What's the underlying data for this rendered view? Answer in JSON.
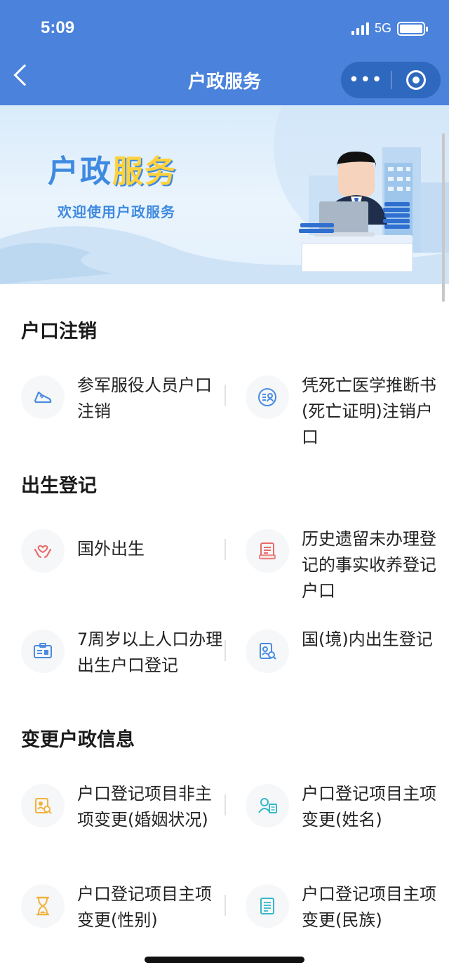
{
  "status_bar": {
    "time": "5:09",
    "network": "5G"
  },
  "nav": {
    "title": "户政服务"
  },
  "banner": {
    "title_part1": "户政",
    "title_part2": "服务",
    "subtitle": "欢迎使用户政服务"
  },
  "sections": [
    {
      "title": "户口注销",
      "items": [
        {
          "label": "参军服役人员户口注销",
          "icon": "running-shoe-icon"
        },
        {
          "label": "凭死亡医学推断书(死亡证明)注销户口",
          "icon": "person-list-icon"
        }
      ]
    },
    {
      "title": "出生登记",
      "items": [
        {
          "label": "国外出生",
          "icon": "caring-hands-icon"
        },
        {
          "label": "历史遗留未办理登记的事实收养登记户口",
          "icon": "document-icon"
        },
        {
          "label": "7周岁以上人口办理出生户口登记",
          "icon": "id-card-icon"
        },
        {
          "label": "国(境)内出生登记",
          "icon": "document-search-icon"
        }
      ]
    },
    {
      "title": "变更户政信息",
      "items": [
        {
          "label": "户口登记项目非主项变更(婚姻状况)",
          "icon": "id-search-icon"
        },
        {
          "label": "户口登记项目主项变更(姓名)",
          "icon": "user-card-icon"
        },
        {
          "label": "户口登记项目主项变更(性别)",
          "icon": "hourglass-icon"
        },
        {
          "label": "户口登记项目主项变更(民族)",
          "icon": "form-icon"
        }
      ]
    }
  ],
  "colors": {
    "nav_bg": "#4a82dc",
    "accent_blue": "#3f8ae0",
    "accent_yellow": "#ffd23c",
    "icon_red": "#e86a6a",
    "icon_orange": "#f0b23c",
    "icon_teal": "#35b8c8"
  }
}
